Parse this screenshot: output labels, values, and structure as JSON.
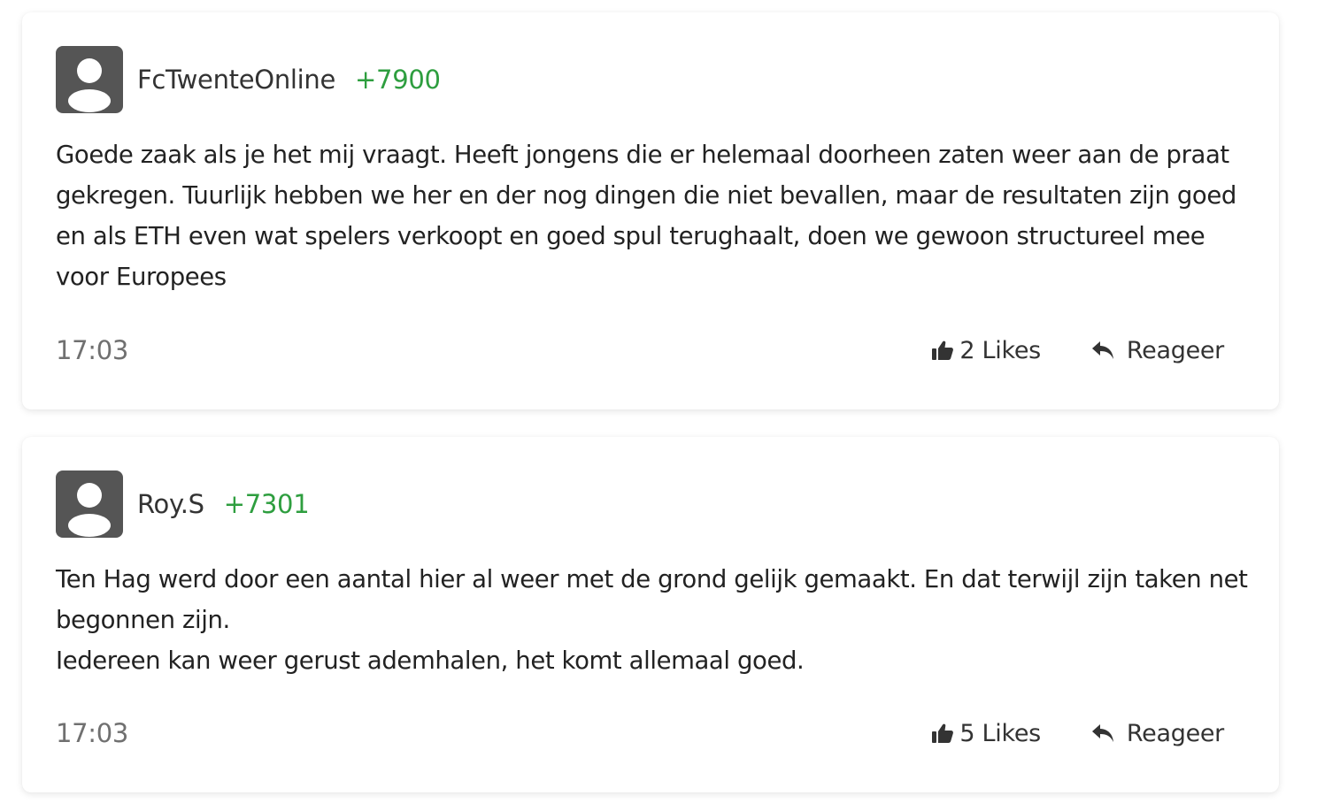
{
  "comments": [
    {
      "username": "FcTwenteOnline",
      "score": "+7900",
      "text": "Goede zaak als je het mij vraagt. Heeft jongens die er helemaal doorheen zaten weer aan de praat gekregen. Tuurlijk hebben we her en der nog dingen die niet bevallen, maar de resultaten zijn goed en als ETH even wat spelers verkoopt en goed spul terughaalt, doen we gewoon structureel mee voor Europees",
      "time": "17:03",
      "likes_label": "2 Likes",
      "reply_label": "Reageer"
    },
    {
      "username": "Roy.S",
      "score": "+7301",
      "text": "Ten Hag werd door een aantal hier al weer met de grond gelijk gemaakt. En dat terwijl zijn taken net begonnen zijn.\nIedereen kan weer gerust ademhalen, het komt allemaal goed.",
      "time": "17:03",
      "likes_label": "5 Likes",
      "reply_label": "Reageer"
    }
  ],
  "icons": {
    "avatar": "user-silhouette-icon",
    "like": "thumbs-up-icon",
    "reply": "reply-arrow-icon"
  },
  "colors": {
    "score": "#2e9e3f",
    "avatar_bg": "#555555",
    "time": "#707070"
  }
}
